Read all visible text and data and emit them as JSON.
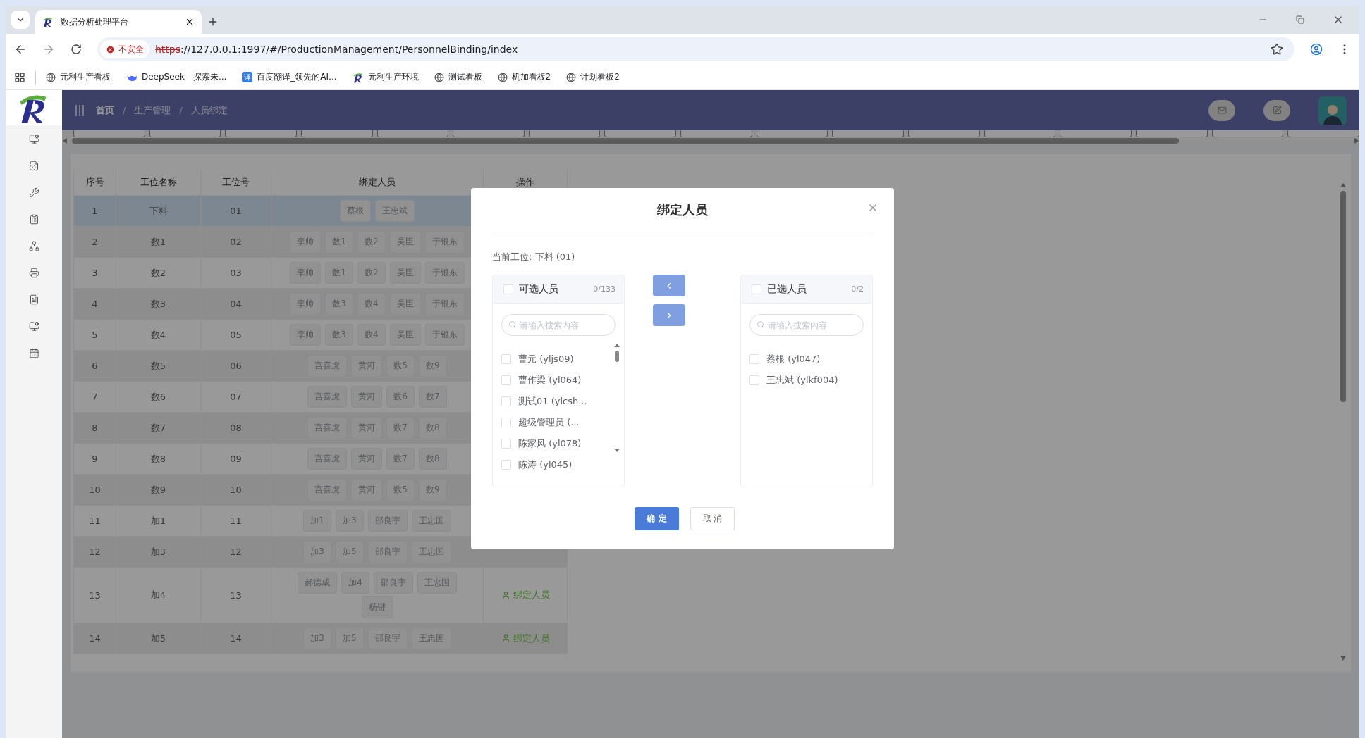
{
  "browser": {
    "tab_title": "数据分析处理平台",
    "security_label": "不安全",
    "url_scheme": "https",
    "url_rest": "://127.0.0.1:1997/#/ProductionManagement/PersonnelBinding/index",
    "bookmarks": [
      {
        "label": "元利生产看板",
        "kind": "globe"
      },
      {
        "label": "DeepSeek - 探索未...",
        "kind": "whale"
      },
      {
        "label": "百度翻译_领先的AI...",
        "kind": "badge",
        "badge": "译"
      },
      {
        "label": "元利生产环境",
        "kind": "logo"
      },
      {
        "label": "测试看板",
        "kind": "globe"
      },
      {
        "label": "机加看板2",
        "kind": "globe"
      },
      {
        "label": "计划看板2",
        "kind": "globe"
      }
    ]
  },
  "breadcrumb": [
    "首页",
    "生产管理",
    "人员绑定"
  ],
  "breadcrumb_separator": "/",
  "table": {
    "columns": [
      "序号",
      "工位名称",
      "工位号",
      "绑定人员",
      "操作"
    ],
    "rows": [
      {
        "no": "1",
        "station": "下料",
        "code": "01",
        "personnel": [
          "蔡根",
          "王忠斌"
        ],
        "selected": true
      },
      {
        "no": "2",
        "station": "数1",
        "code": "02",
        "personnel": [
          "李帅",
          "数1",
          "数2",
          "吴臣",
          "于银东"
        ],
        "selected": false
      },
      {
        "no": "3",
        "station": "数2",
        "code": "03",
        "personnel": [
          "李帅",
          "数1",
          "数2",
          "吴臣",
          "于银东"
        ],
        "selected": false
      },
      {
        "no": "4",
        "station": "数3",
        "code": "04",
        "personnel": [
          "李帅",
          "数3",
          "数4",
          "吴臣",
          "于银东"
        ],
        "selected": false
      },
      {
        "no": "5",
        "station": "数4",
        "code": "05",
        "personnel": [
          "李帅",
          "数3",
          "数4",
          "吴臣",
          "于银东"
        ],
        "selected": false
      },
      {
        "no": "6",
        "station": "数5",
        "code": "06",
        "personnel": [
          "宫喜虎",
          "黄河",
          "数5",
          "数9"
        ],
        "selected": false
      },
      {
        "no": "7",
        "station": "数6",
        "code": "07",
        "personnel": [
          "宫喜虎",
          "黄河",
          "数6",
          "数7"
        ],
        "selected": false
      },
      {
        "no": "8",
        "station": "数7",
        "code": "08",
        "personnel": [
          "宫喜虎",
          "黄河",
          "数7",
          "数8"
        ],
        "selected": false
      },
      {
        "no": "9",
        "station": "数8",
        "code": "09",
        "personnel": [
          "宫喜虎",
          "黄河",
          "数7",
          "数8"
        ],
        "selected": false
      },
      {
        "no": "10",
        "station": "数9",
        "code": "10",
        "personnel": [
          "宫喜虎",
          "黄河",
          "数5",
          "数9"
        ],
        "selected": false
      },
      {
        "no": "11",
        "station": "加1",
        "code": "11",
        "personnel": [
          "加1",
          "加3",
          "邵良宇",
          "王忠国"
        ],
        "selected": false
      },
      {
        "no": "12",
        "station": "加3",
        "code": "12",
        "personnel": [
          "加3",
          "加5",
          "邵良宇",
          "王忠国"
        ],
        "selected": false
      },
      {
        "no": "13",
        "station": "加4",
        "code": "13",
        "personnel": [
          "郝德成",
          "加4",
          "邵良宇",
          "王忠国",
          "杨键"
        ],
        "selected": false,
        "action": "绑定人员"
      },
      {
        "no": "14",
        "station": "加5",
        "code": "14",
        "personnel": [
          "加3",
          "加5",
          "邵良宇",
          "王忠国"
        ],
        "selected": false,
        "action": "绑定人员"
      }
    ]
  },
  "dialog": {
    "title": "绑定人员",
    "current_station": "当前工位: 下料 (01)",
    "panels": [
      {
        "title": "可选人员",
        "count": "0/133",
        "all_checked": false,
        "search_placeholder": "请输入搜索内容",
        "scrollable": true,
        "items": [
          {
            "label": "曹元 (yljs09)",
            "checked": false
          },
          {
            "label": "曹作梁 (yl064)",
            "checked": false
          },
          {
            "label": "测试01 (ylcsh...",
            "checked": false
          },
          {
            "label": "超级管理员 (...",
            "checked": false
          },
          {
            "label": "陈家风 (yl078)",
            "checked": false
          },
          {
            "label": "陈涛 (yl045)",
            "checked": false
          }
        ]
      },
      {
        "title": "已选人员",
        "count": "0/2",
        "all_checked": false,
        "search_placeholder": "请输入搜索内容",
        "scrollable": false,
        "items": [
          {
            "label": "蔡根 (yl047)",
            "checked": false
          },
          {
            "label": "王忠斌 (ylkf004)",
            "checked": false
          }
        ]
      }
    ],
    "confirm": "确 定",
    "cancel": "取 消"
  }
}
